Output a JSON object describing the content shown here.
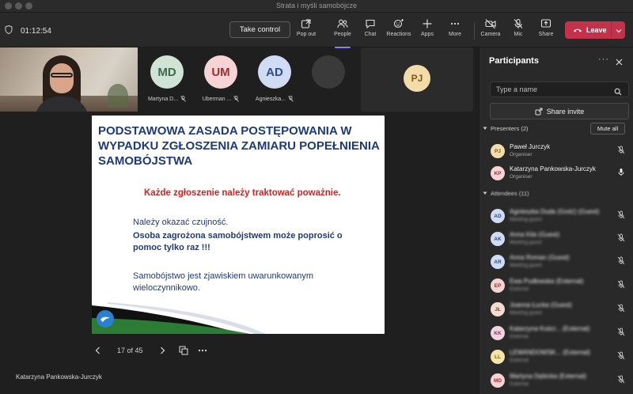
{
  "window": {
    "title": "Strata i myśli samobójcze"
  },
  "toolbar": {
    "timer": "01:12:54",
    "take_control": "Take control",
    "buttons": [
      {
        "label": "Pop out",
        "icon": "pop-out-icon"
      },
      {
        "label": "People",
        "icon": "people-icon",
        "active": true
      },
      {
        "label": "Chat",
        "icon": "chat-icon"
      },
      {
        "label": "Reactions",
        "icon": "reactions-icon"
      },
      {
        "label": "Apps",
        "icon": "plus-icon"
      },
      {
        "label": "More",
        "icon": "more-icon"
      },
      {
        "label": "Camera",
        "icon": "camera-off-icon"
      },
      {
        "label": "Mic",
        "icon": "mic-off-icon"
      },
      {
        "label": "Share",
        "icon": "share-icon"
      }
    ],
    "leave": "Leave",
    "colors": {
      "leave": "#c4314b",
      "accent": "#7f85f5"
    }
  },
  "video_strip": {
    "tiles": [
      {
        "initials": "MD",
        "name": "Martyna D...",
        "bg": "#cfe3d6",
        "fg": "#3c6b4a"
      },
      {
        "initials": "UM",
        "name": "Uberman ...",
        "bg": "#f6d3d4",
        "fg": "#9b2f35"
      },
      {
        "initials": "AD",
        "name": "Agnieszka...",
        "bg": "#cfdcf4",
        "fg": "#2e4d8a"
      }
    ],
    "pj_tile": {
      "initials": "PJ"
    }
  },
  "slide": {
    "heading": "PODSTAWOWA ZASADA POSTĘPOWANIA W WYPADKU ZGŁOSZENIA ZAMIARU POPEŁNIENIA SAMOBÓJSTWA",
    "red_line": "Każde zgłoszenie należy  traktować poważnie.",
    "p1": "Należy okazać czujność.",
    "p2": "Osoba zagrożona samobójstwem może poprosić o pomoc tylko raz !!!",
    "p3": "Samobójstwo jest zjawiskiem uwarunkowanym wieloczynnikowo.",
    "page_indicator": "17 of 45"
  },
  "presenter_name": "Katarzyna Pankowska-Jurczyk",
  "panel": {
    "title": "Participants",
    "search_placeholder": "Type a name",
    "share_invite": "Share invite",
    "presenters_label": "Presenters (2)",
    "mute_all": "Mute all",
    "attendees_label": "Attendees (11)",
    "presenters": [
      {
        "initials": "PJ",
        "name": "Paweł Jurczyk",
        "role": "Organiser",
        "bg": "#f3dcaa",
        "fg": "#7a5a17",
        "mic": "mic-off-icon"
      },
      {
        "initials": "KP",
        "name": "Katarzyna Pankowska-Jurczyk",
        "role": "Organiser",
        "bg": "#f6d3d4",
        "fg": "#9b2f35",
        "mic": "mic-on-icon"
      }
    ],
    "attendees": [
      {
        "initials": "AD",
        "name": "Agnieszka Duda (Gość) (Guest)",
        "role": "Meeting guest",
        "bg": "#cfdcf4",
        "fg": "#2e4d8a"
      },
      {
        "initials": "AK",
        "name": "Anna Kila (Guest)",
        "role": "Meeting guest",
        "bg": "#cfdcf4",
        "fg": "#2e4d8a"
      },
      {
        "initials": "AR",
        "name": "Anna Roman (Guest)",
        "role": "Meeting guest",
        "bg": "#cfdcf4",
        "fg": "#2e4d8a"
      },
      {
        "initials": "EP",
        "name": "Ewa Pudłowska (External)",
        "role": "External",
        "bg": "#f6d3d4",
        "fg": "#9b2f35"
      },
      {
        "initials": "JŁ",
        "name": "Joanna Łucka (Guest)",
        "role": "Meeting guest",
        "bg": "#f3dcd0",
        "fg": "#7a4a2e"
      },
      {
        "initials": "KK",
        "name": "Katarzyna Kości... (External)",
        "role": "External",
        "bg": "#f0d4e4",
        "fg": "#8a2e5c"
      },
      {
        "initials": "LL",
        "name": "LEWANDOWSK... (External)",
        "role": "External",
        "bg": "#f3e6aa",
        "fg": "#7a6617"
      },
      {
        "initials": "MD",
        "name": "Martyna Dębicka (External)",
        "role": "External",
        "bg": "#f6d3d4",
        "fg": "#9b2f35"
      }
    ]
  }
}
